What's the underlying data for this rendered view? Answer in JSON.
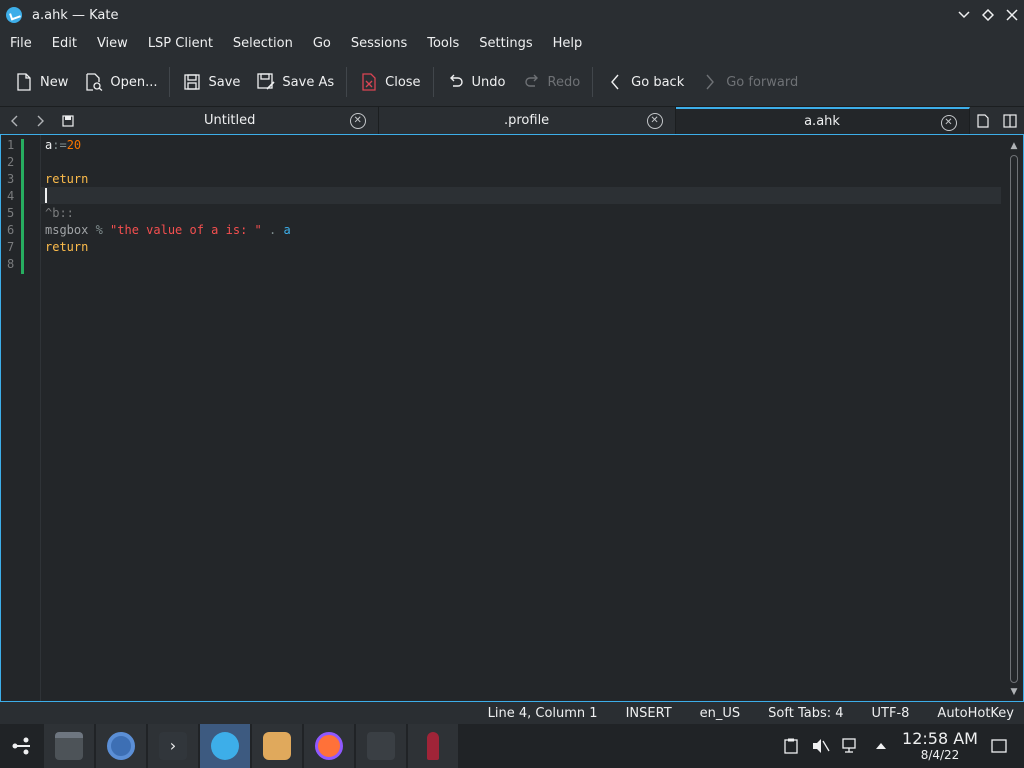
{
  "window": {
    "title": "a.ahk — Kate"
  },
  "menu": [
    "File",
    "Edit",
    "View",
    "LSP Client",
    "Selection",
    "Go",
    "Sessions",
    "Tools",
    "Settings",
    "Help"
  ],
  "toolbar": {
    "new_label": "New",
    "open_label": "Open...",
    "save_label": "Save",
    "save_as_label": "Save As",
    "close_label": "Close",
    "undo_label": "Undo",
    "redo_label": "Redo",
    "go_back_label": "Go back",
    "go_forward_label": "Go forward"
  },
  "tabs": [
    {
      "label": "Untitled",
      "active": false
    },
    {
      "label": ".profile",
      "active": false
    },
    {
      "label": "a.ahk",
      "active": true
    }
  ],
  "editor": {
    "line_numbers": [
      "1",
      "2",
      "3",
      "4",
      "5",
      "6",
      "7",
      "8"
    ],
    "lines": {
      "l1": {
        "var": "a",
        "op": ":=",
        "num": "20"
      },
      "l3": {
        "kw": "return"
      },
      "l5": {
        "hotkey": "^b::"
      },
      "l6": {
        "fn": "msgbox ",
        "op": "% ",
        "str": "\"the value of a is: \"",
        "dot": " . ",
        "id": "a"
      },
      "l7": {
        "kw": "return"
      }
    }
  },
  "status": {
    "position": "Line 4, Column 1",
    "mode": "INSERT",
    "dictionary": "en_US",
    "indentation": "Soft Tabs: 4",
    "encoding": "UTF-8",
    "syntax": "AutoHotKey"
  },
  "taskbar": {
    "clock_time": "12:58 AM",
    "clock_date": "8/4/22"
  },
  "colors": {
    "accent": "#3daee9",
    "modified_marker": "#27ae60",
    "background": "#232629"
  }
}
